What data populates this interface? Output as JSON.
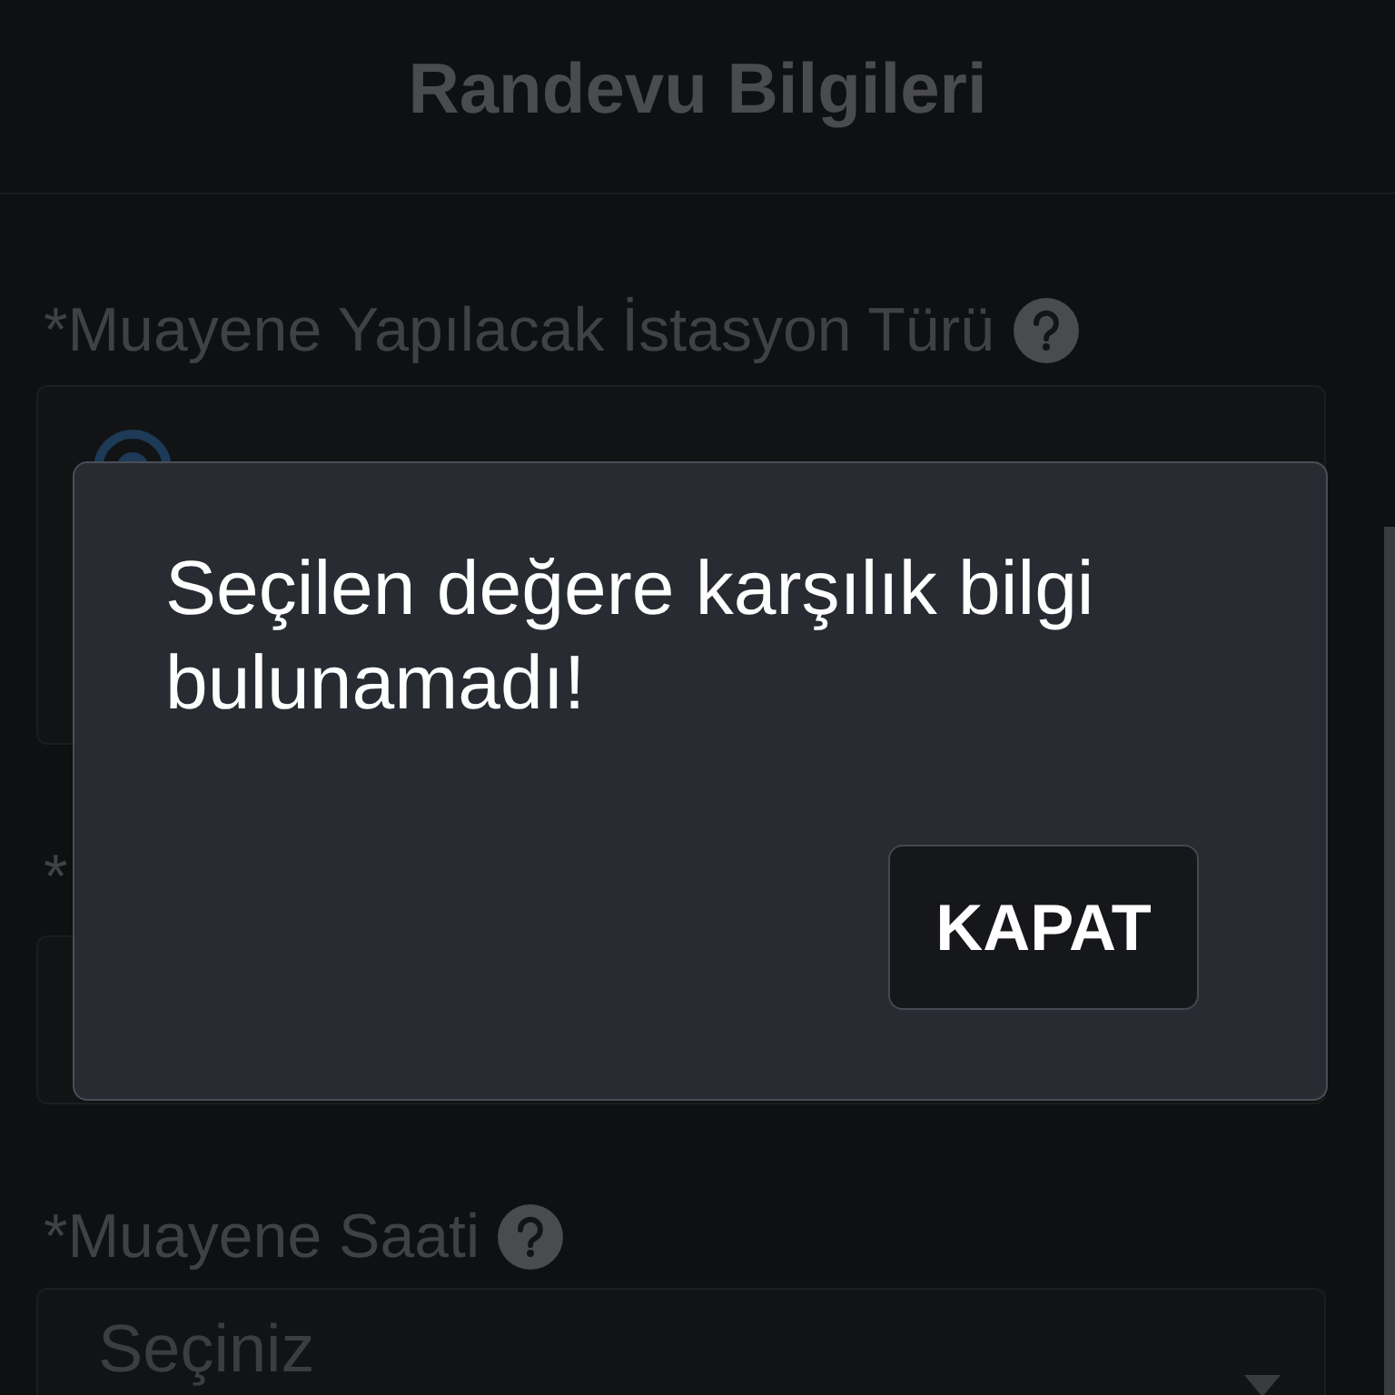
{
  "header": {
    "title": "Randevu Bilgileri"
  },
  "form": {
    "fields": [
      {
        "kind": "radio_group",
        "label": "*Muayene Yapılacak İstasyon Türü",
        "help": true
      },
      {
        "kind": "input",
        "label": "*"
      },
      {
        "kind": "select",
        "label": "*Muayene Saati",
        "help": true,
        "placeholder": "Seçiniz"
      }
    ]
  },
  "dialog": {
    "message": "Seçilen değere karşılık bilgi bulunamadı!",
    "buttons": [
      "KAPAT"
    ]
  }
}
